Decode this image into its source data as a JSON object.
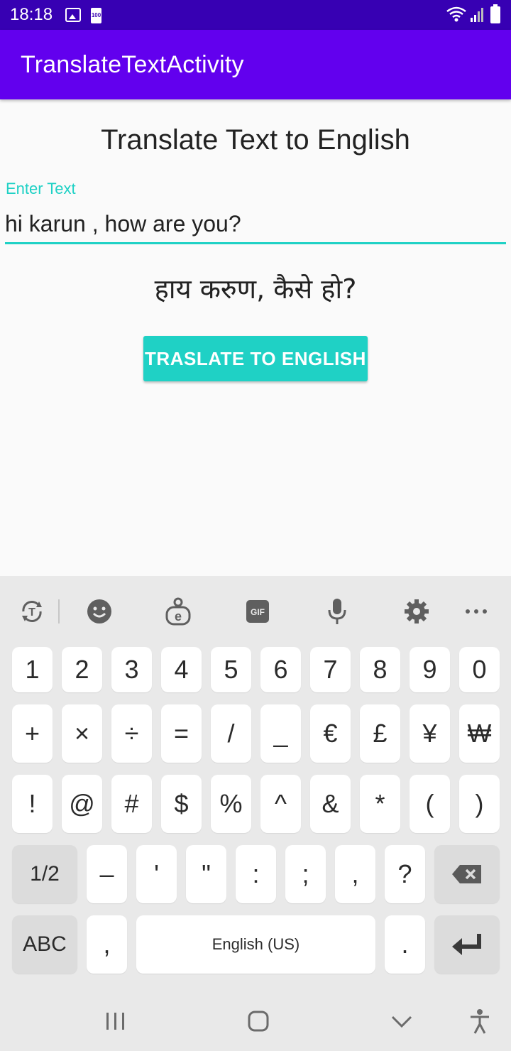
{
  "status_bar": {
    "time": "18:18"
  },
  "app_bar": {
    "title": "TranslateTextActivity"
  },
  "main": {
    "heading": "Translate Text to English",
    "input_label": "Enter Text",
    "input_value": "hi karun , how are you?",
    "translated_text": "हाय करुण, कैसे हो?",
    "translate_button": "TRASLATE TO ENGLISH"
  },
  "keyboard": {
    "row1": [
      "1",
      "2",
      "3",
      "4",
      "5",
      "6",
      "7",
      "8",
      "9",
      "0"
    ],
    "row2": [
      "+",
      "×",
      "÷",
      "=",
      "/",
      "_",
      "€",
      "£",
      "¥",
      "₩"
    ],
    "row3": [
      "!",
      "@",
      "#",
      "$",
      "%",
      "^",
      "&",
      "*",
      "(",
      ")"
    ],
    "row4": [
      "1/2",
      "–",
      "'",
      "\"",
      ":",
      ";",
      ",",
      "?"
    ],
    "row5": [
      "ABC",
      ",",
      "English (US)",
      "."
    ]
  },
  "colors": {
    "status_bar": "#3700b3",
    "app_bar": "#6200ee",
    "accent": "#1fd1c5"
  }
}
